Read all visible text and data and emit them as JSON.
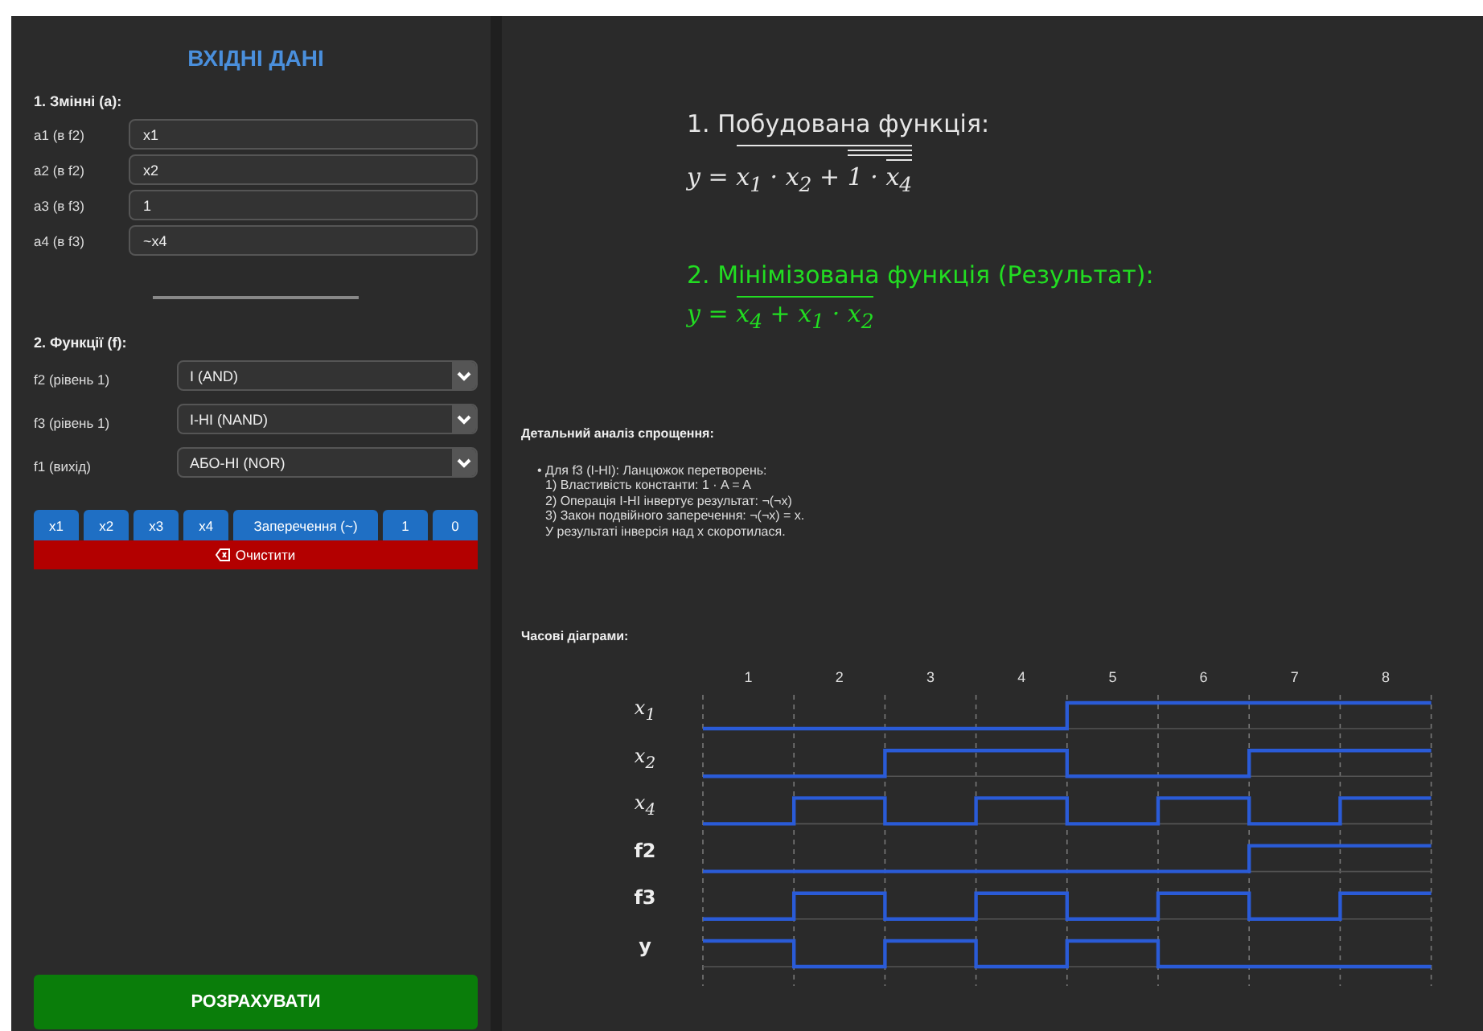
{
  "input_panel": {
    "title": "ВХІДНІ ДАНІ",
    "variables_heading": "1. Змінні (a):",
    "variables": [
      {
        "label": "a1 (в f2)",
        "value": "x1"
      },
      {
        "label": "a2 (в f2)",
        "value": "x2"
      },
      {
        "label": "a3 (в f3)",
        "value": "1"
      },
      {
        "label": "a4 (в f3)",
        "value": "~x4"
      }
    ],
    "functions_heading": "2. Функції (f):",
    "functions": [
      {
        "label": "f2 (рівень 1)",
        "value": "І (AND)"
      },
      {
        "label": "f3 (рівень 1)",
        "value": "І-НІ (NAND)"
      },
      {
        "label": "f1 (вихід)",
        "value": "АБО-НІ (NOR)"
      }
    ],
    "insert_buttons": [
      "x1",
      "x2",
      "x3",
      "x4",
      "Заперечення (~)",
      "1",
      "0"
    ],
    "clear_button": "Очистити",
    "calculate_button": "РОЗРАХУВАТИ"
  },
  "results": {
    "built": {
      "heading": "1. Побудована функція:",
      "lhs": "y =",
      "body": [
        {
          "over": [
            {
              "text": "x$_{1}$ · x$_{2}$ + "
            },
            {
              "over": [
                {
                  "over": [
                    {
                      "text": "1 · "
                    },
                    {
                      "over": [
                        {
                          "text": "x$_{4}$"
                        }
                      ]
                    }
                  ]
                }
              ]
            }
          ]
        }
      ]
    },
    "minimized": {
      "heading": "2. Мінімізована функція (Результат):",
      "lhs": "y =",
      "body": [
        {
          "over": [
            {
              "text": "x$_{4}$ + x$_{1}$ · x$_{2}$"
            }
          ]
        }
      ]
    },
    "analysis": {
      "title": "Детальний аналіз спрощення:",
      "bullet": "•",
      "lead": "Для f3 (І-НІ): Ланцюжок перетворень:",
      "lines": [
        "1) Властивість константи: 1 · A = A",
        "2) Операція І-НІ інвертує результат: ¬(¬x)",
        "3) Закон подвійного заперечення: ¬(¬x) = x.",
        "У результаті інверсія над x скоротилася."
      ]
    },
    "timing_title": "Часові діаграми:",
    "timing": {
      "steps": [
        "1",
        "2",
        "3",
        "4",
        "5",
        "6",
        "7",
        "8"
      ],
      "signals": [
        {
          "name": "x$_{1}$",
          "kind": "variable"
        },
        {
          "name": "x$_{2}$",
          "kind": "variable"
        },
        {
          "name": "x$_{4}$",
          "kind": "variable"
        },
        {
          "name": "f2",
          "kind": "function"
        },
        {
          "name": "f3",
          "kind": "function"
        },
        {
          "name": "y",
          "kind": "function"
        }
      ]
    }
  }
}
